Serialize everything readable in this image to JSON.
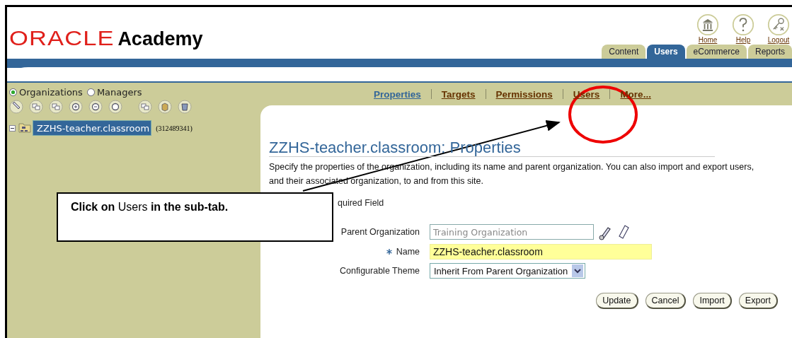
{
  "logo": {
    "brand": "ORACLE",
    "product": "Academy"
  },
  "global_links": [
    {
      "label": "Home",
      "kind": "home"
    },
    {
      "label": "Help",
      "kind": "help"
    },
    {
      "label": "Logout",
      "kind": "logout"
    }
  ],
  "tabs": [
    {
      "label": "Content",
      "selected": false
    },
    {
      "label": "Users",
      "selected": true
    },
    {
      "label": "eCommerce",
      "selected": false
    },
    {
      "label": "Reports",
      "selected": false
    }
  ],
  "sidebar": {
    "view_options": [
      {
        "label": "Organizations",
        "selected": true
      },
      {
        "label": "Managers",
        "selected": false
      }
    ],
    "tree": [
      {
        "label": "ZZHS-teacher.classroom",
        "id_text": "(312489341)",
        "expanded": true,
        "selected": true
      }
    ]
  },
  "subtabs": [
    {
      "label": "Properties",
      "selected": true
    },
    {
      "label": "Targets",
      "selected": false
    },
    {
      "label": "Permissions",
      "selected": false
    },
    {
      "label": "Users",
      "selected": false
    },
    {
      "label": "More...",
      "selected": false
    }
  ],
  "page": {
    "title": "ZZHS-teacher.classroom: Properties",
    "description": "Specify the properties of the organization, including its name and parent organization. You can also import and export users, and their associated organization, to and from this site.",
    "required_note": "quired Field",
    "fields": [
      {
        "kind": "lov",
        "label": "Parent Organization",
        "value": "Training Organization",
        "required": false,
        "disabled": true
      },
      {
        "kind": "text",
        "label": "Name",
        "value": "ZZHS-teacher.classroom",
        "required": true,
        "disabled": false
      },
      {
        "kind": "select",
        "label": "Configurable Theme",
        "value": "Inherit From Parent Organization",
        "required": false,
        "disabled": false
      }
    ],
    "buttons": [
      "Update",
      "Cancel",
      "Import",
      "Export"
    ]
  },
  "callout": {
    "text": "**Click on** Users **in the sub-tab.**"
  }
}
